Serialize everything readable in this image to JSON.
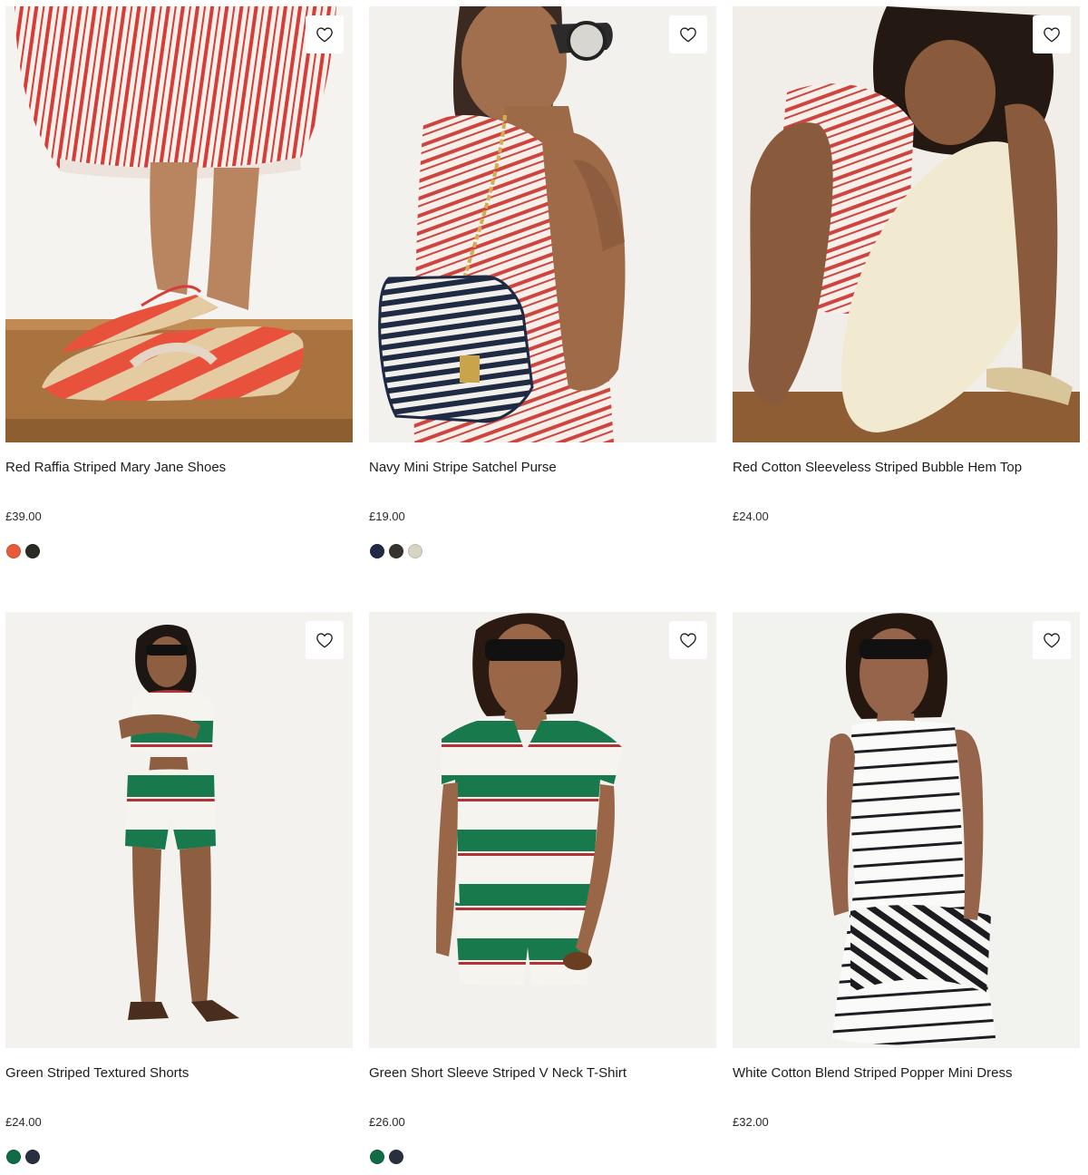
{
  "products": [
    {
      "title": "Red Raffia Striped Mary Jane Shoes",
      "price": "£39.00",
      "swatches": [
        "#e85a3c",
        "#2b2b26"
      ],
      "image_icon": "shoes-image"
    },
    {
      "title": "Navy Mini Stripe Satchel Purse",
      "price": "£19.00",
      "swatches": [
        "#1f2a44",
        "#36342c",
        "#d8d4c3"
      ],
      "image_icon": "bag-image"
    },
    {
      "title": "Red Cotton Sleeveless Striped Bubble Hem Top",
      "price": "£24.00",
      "swatches": [],
      "image_icon": "top-image"
    },
    {
      "title": "Green Striped Textured Shorts",
      "price": "£24.00",
      "swatches": [
        "#116b45",
        "#283040"
      ],
      "image_icon": "shorts-image"
    },
    {
      "title": "Green Short Sleeve Striped V Neck T-Shirt",
      "price": "£26.00",
      "swatches": [
        "#116b45",
        "#283040"
      ],
      "image_icon": "tshirt-image"
    },
    {
      "title": "White Cotton Blend Striped Popper Mini Dress",
      "price": "£32.00",
      "swatches": [],
      "image_icon": "dress-image"
    }
  ],
  "wishlist_icon": "heart-icon"
}
